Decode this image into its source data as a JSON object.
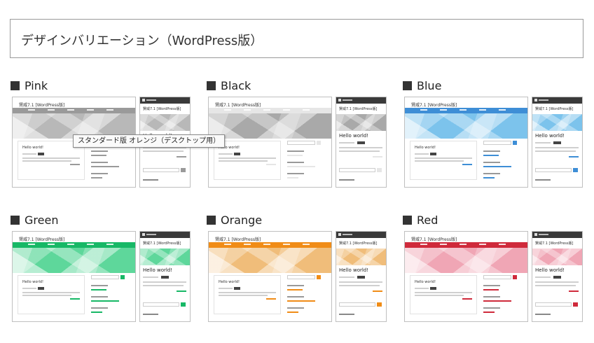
{
  "page": {
    "title": "デザインバリエーション（WordPress版）"
  },
  "site_title": "賢威7.1 [WordPress版]",
  "post_title": "Hello world!",
  "variants": [
    {
      "name": "Pink",
      "color": "#9a9a9a",
      "hero": "#b8b8b8"
    },
    {
      "name": "Black",
      "color": "#e6e6e6",
      "hero": "#a9a9a9"
    },
    {
      "name": "Blue",
      "color": "#3e8ed6",
      "hero": "#7cc3ec"
    },
    {
      "name": "Green",
      "color": "#17b866",
      "hero": "#5ed79b"
    },
    {
      "name": "Orange",
      "color": "#f08c17",
      "hero": "#f0bd7a"
    },
    {
      "name": "Red",
      "color": "#cf2a3b",
      "hero": "#f0a6b5"
    }
  ],
  "tooltip": {
    "text": "スタンダード版 オレンジ（デスクトップ用）"
  }
}
